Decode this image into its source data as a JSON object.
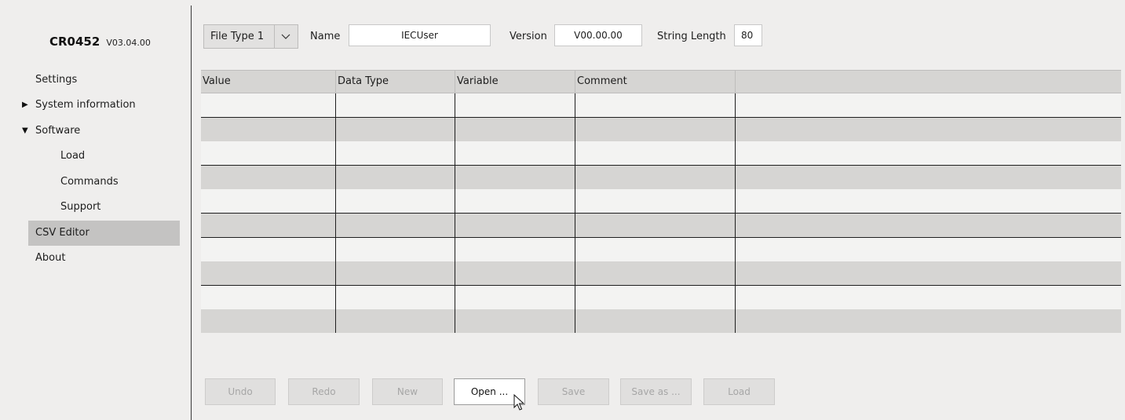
{
  "app": {
    "device": "CR0452",
    "version": "V03.04.00"
  },
  "sidebar": {
    "items": [
      {
        "label": "Settings"
      },
      {
        "label": "System information",
        "expander": "collapsed"
      },
      {
        "label": "Software",
        "expander": "expanded"
      },
      {
        "label": "Load"
      },
      {
        "label": "Commands"
      },
      {
        "label": "Support"
      },
      {
        "label": "CSV Editor",
        "active": true
      },
      {
        "label": "About"
      }
    ]
  },
  "toolbar": {
    "file_type": "File Type 1",
    "name_label": "Name",
    "name_value": "IECUser",
    "version_label": "Version",
    "version_value": "V00.00.00",
    "string_length_label": "String Length",
    "string_length_value": "80"
  },
  "table": {
    "columns": [
      "Value",
      "Data Type",
      "Variable",
      "Comment",
      ""
    ],
    "rows": [
      [
        "",
        "",
        "",
        "",
        ""
      ],
      [
        "",
        "",
        "",
        "",
        ""
      ],
      [
        "",
        "",
        "",
        "",
        ""
      ],
      [
        "",
        "",
        "",
        "",
        ""
      ],
      [
        "",
        "",
        "",
        "",
        ""
      ],
      [
        "",
        "",
        "",
        "",
        ""
      ],
      [
        "",
        "",
        "",
        "",
        ""
      ],
      [
        "",
        "",
        "",
        "",
        ""
      ],
      [
        "",
        "",
        "",
        "",
        ""
      ],
      [
        "",
        "",
        "",
        "",
        ""
      ]
    ]
  },
  "buttons": {
    "undo": "Undo",
    "redo": "Redo",
    "new": "New",
    "open": "Open ...",
    "save": "Save",
    "save_as": "Save as ...",
    "load": "Load"
  },
  "colors": {
    "active_nav": "#c4c3c2",
    "row_light": "#f3f3f2",
    "row_dark": "#d6d5d3",
    "background": "#efeeed"
  }
}
